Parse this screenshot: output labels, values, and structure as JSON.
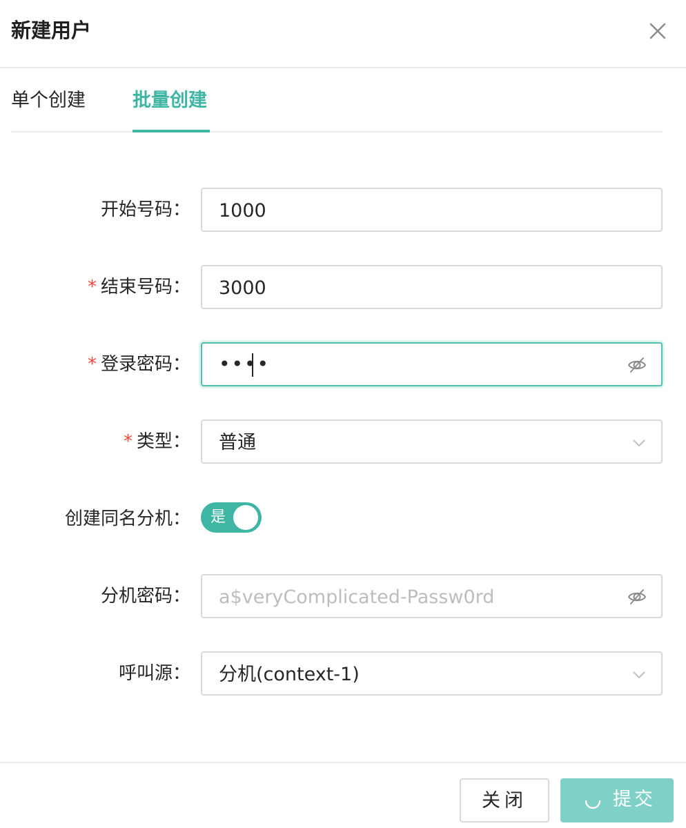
{
  "dialog": {
    "title": "新建用户",
    "close_icon": "close-icon"
  },
  "tabs": [
    {
      "label": "单个创建",
      "active": false
    },
    {
      "label": "批量创建",
      "active": true
    }
  ],
  "form": {
    "start_number": {
      "label": "开始号码：",
      "required": false,
      "value": "1000"
    },
    "end_number": {
      "label": "结束号码：",
      "required": true,
      "required_mark": "*",
      "value": "3000"
    },
    "login_password": {
      "label": "登录密码：",
      "required": true,
      "required_mark": "*",
      "masked_value": "••••",
      "icon": "eye-slash-icon"
    },
    "type": {
      "label": "类型：",
      "required": true,
      "required_mark": "*",
      "selected": "普通",
      "icon": "chevron-down-icon"
    },
    "create_extension": {
      "label": "创建同名分机：",
      "switch_text": "是",
      "on": true
    },
    "extension_password": {
      "label": "分机密码：",
      "placeholder": "a$veryComplicated-Passw0rd",
      "icon": "eye-slash-icon"
    },
    "call_source": {
      "label": "呼叫源：",
      "selected": "分机(context-1)",
      "icon": "chevron-down-icon"
    }
  },
  "footer": {
    "close_label": "关闭",
    "submit_label": "提交",
    "submit_loading": true
  },
  "colors": {
    "accent": "#3fb5a4",
    "accent_disabled": "#7fd1c7",
    "required": "#f5483b",
    "border": "#d9d9d9",
    "placeholder": "#bdbdbd"
  }
}
